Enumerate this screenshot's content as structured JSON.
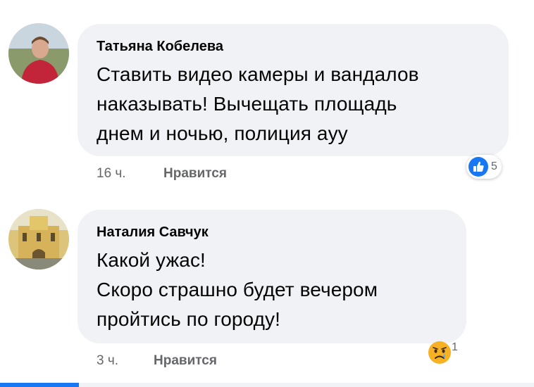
{
  "comments": [
    {
      "author": "Татьяна Кобелева",
      "lines": [
        "Ставить видео камеры и вандалов",
        "наказывать! Вычещать площадь",
        "днем и ночью, полиция аyy"
      ],
      "time": "16 ч.",
      "like_label": "Нравится",
      "reaction_icon": "thumbs-up-icon",
      "reaction_count": "5"
    },
    {
      "author": "Наталия Савчук",
      "lines": [
        "Какой ужас!",
        "Скоро страшно будет вечером",
        "пройтись по городу!"
      ],
      "time": "3 ч.",
      "like_label": "Нравится",
      "reaction_icon": "sad-face-icon",
      "reaction_count": "1"
    }
  ],
  "colors": {
    "bubble": "#f0f2f5",
    "meta_text": "#65676b",
    "like_blue": "#1877f2",
    "sad_yellow": "#f7b125"
  }
}
